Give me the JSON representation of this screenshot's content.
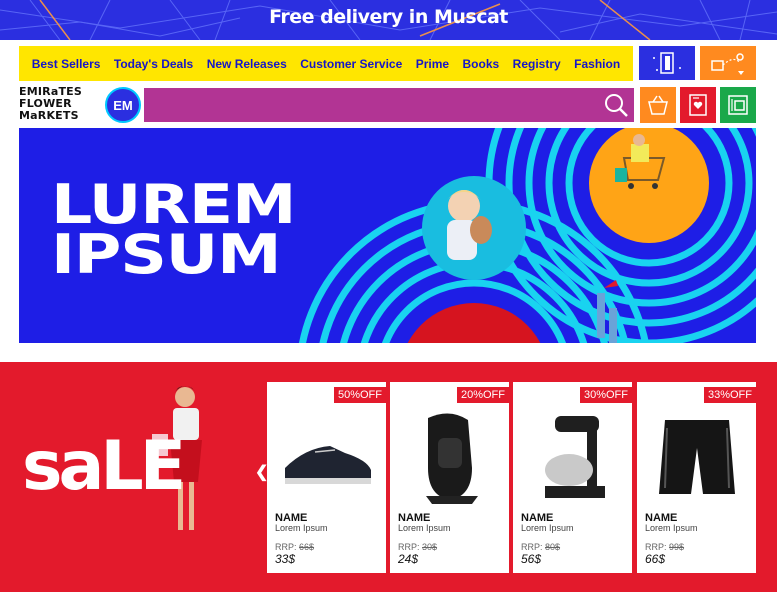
{
  "banner": {
    "text": "Free delivery in Muscat"
  },
  "nav": {
    "links": [
      "Best Sellers",
      "Today's Deals",
      "New Releases",
      "Customer Service",
      "Prime",
      "Books",
      "Registry",
      "Fashion"
    ]
  },
  "icon_tiles": [
    {
      "name": "door-icon",
      "color": "#2b2fe0"
    },
    {
      "name": "map-delivery-icon",
      "color": "#ff8a1f"
    },
    {
      "name": "basket-icon",
      "color": "#ff8a1f"
    },
    {
      "name": "gift-card-icon",
      "color": "#e31a2c"
    },
    {
      "name": "voucher-icon",
      "color": "#1aa84a"
    }
  ],
  "logo": {
    "line1": "EMIRaTES",
    "line2": "FLOWER",
    "line3": "MaRKETS",
    "emblem": "EM"
  },
  "search": {
    "placeholder": ""
  },
  "hero": {
    "title_line1": "LUREM",
    "title_line2": "IPSUM"
  },
  "sale": {
    "word": "saLE",
    "products": [
      {
        "badge": "50%OFF",
        "name": "NAME",
        "desc": "Lorem Ipsum",
        "rrp_label": "RRP: ",
        "rrp_value": "66$",
        "price": "33$",
        "image": "shoe-icon"
      },
      {
        "badge": "20%OFF",
        "name": "NAME",
        "desc": "Lorem Ipsum",
        "rrp_label": "RRP: ",
        "rrp_value": "30$",
        "price": "24$",
        "image": "car-seat-icon"
      },
      {
        "badge": "30%OFF",
        "name": "NAME",
        "desc": "Lorem Ipsum",
        "rrp_label": "RRP: ",
        "rrp_value": "80$",
        "price": "56$",
        "image": "mixer-icon"
      },
      {
        "badge": "33%OFF",
        "name": "NAME",
        "desc": "Lorem Ipsum",
        "rrp_label": "RRP: ",
        "rrp_value": "99$",
        "price": "66$",
        "image": "shorts-icon"
      }
    ]
  },
  "colors": {
    "brand_blue": "#2b2fe0",
    "yellow": "#ffe600",
    "sale_red": "#e31a2c",
    "search_magenta": "#b23494",
    "cyan": "#19d3f0"
  }
}
